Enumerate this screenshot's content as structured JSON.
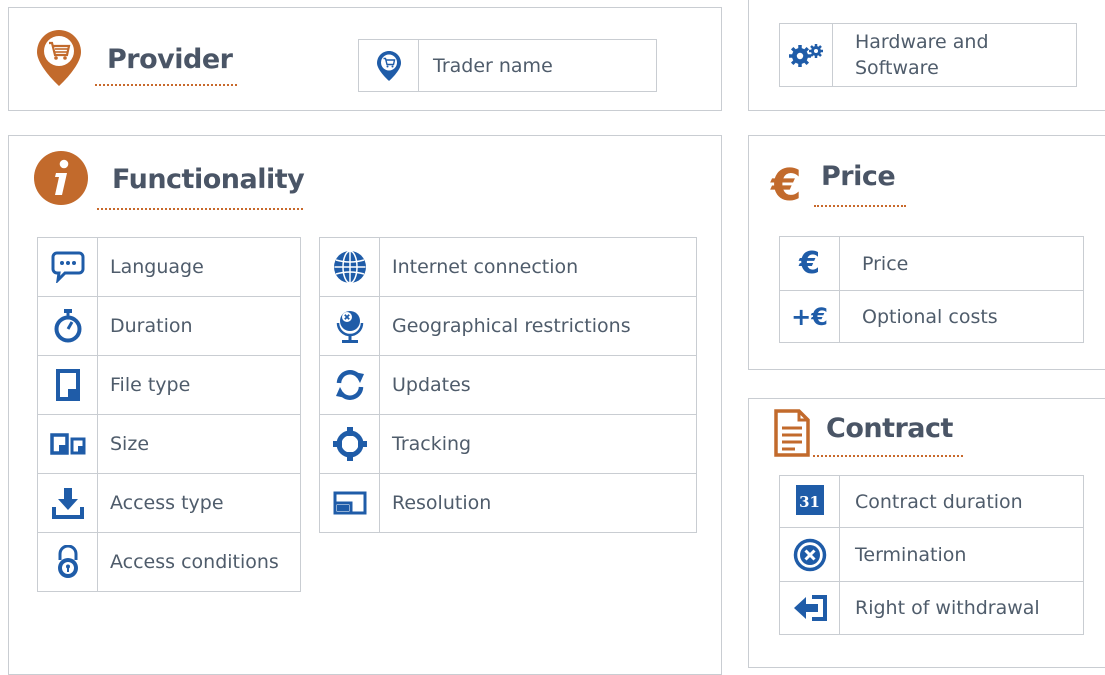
{
  "provider": {
    "title": "Provider",
    "field": "Trader name"
  },
  "hardware": {
    "line1": "Hardware and",
    "line2": "Software"
  },
  "functionality": {
    "title": "Functionality",
    "left": [
      "Language",
      "Duration",
      "File type",
      "Size",
      "Access type",
      "Access conditions"
    ],
    "right": [
      "Internet connection",
      "Geographical restrictions",
      "Updates",
      "Tracking",
      "Resolution"
    ]
  },
  "price": {
    "title": "Price",
    "items": [
      "Price",
      "Optional costs"
    ]
  },
  "contract": {
    "title": "Contract",
    "items": [
      "Contract duration",
      "Termination",
      "Right of withdrawal"
    ],
    "calendar_day": "31"
  },
  "colors": {
    "accent": "#c26a2c",
    "icon_blue": "#1f5ca8",
    "text": "#4f5c6b",
    "border": "#c9cdd2"
  }
}
